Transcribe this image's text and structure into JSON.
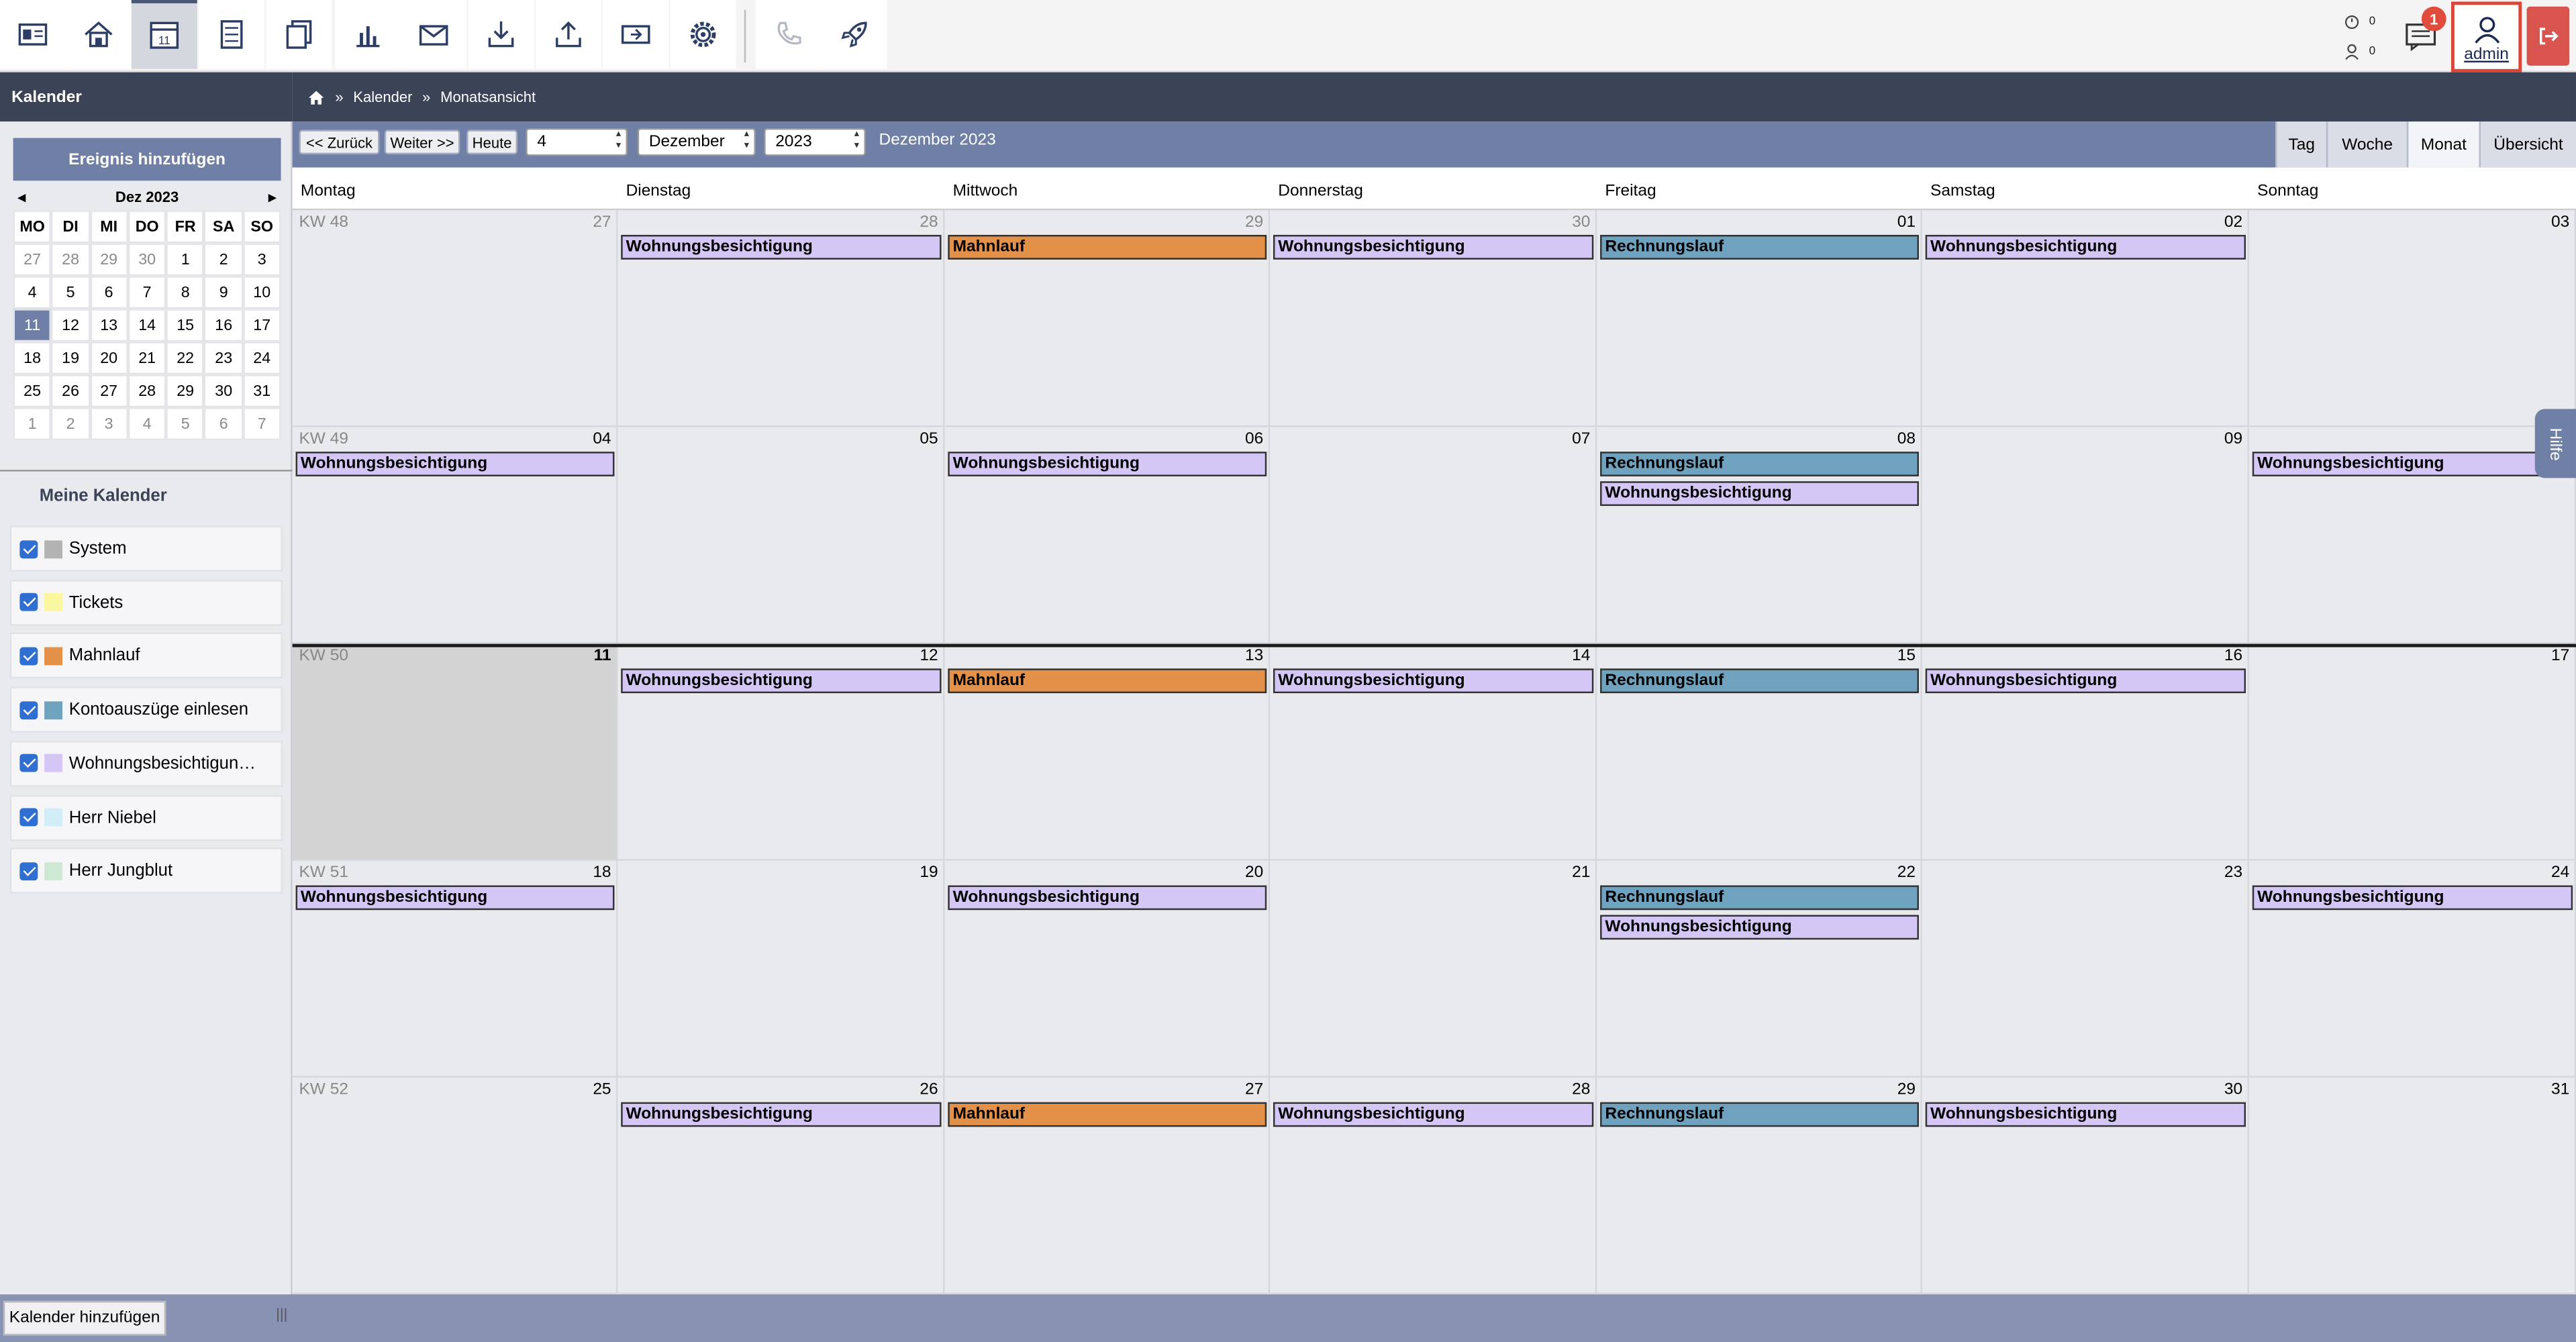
{
  "toolbar": {
    "icons": [
      "contacts-icon",
      "home-icon",
      "calendar-icon",
      "accounting-icon",
      "documents-icon",
      "reports-icon",
      "mail-icon",
      "import-icon",
      "export-icon",
      "ticket-icon",
      "settings-icon",
      "phone-icon",
      "rocket-icon"
    ],
    "calendar_day": "11",
    "stat_a": "0",
    "stat_b": "0",
    "message_badge": "1",
    "user": "admin"
  },
  "sidebar": {
    "title": "Kalender",
    "add_event": "Ereignis hinzufügen",
    "mini_month": "Dez 2023",
    "prev": "◂",
    "next": "▸",
    "dow": [
      "MO",
      "DI",
      "MI",
      "DO",
      "FR",
      "SA",
      "SO"
    ],
    "weeks": [
      [
        "27",
        "28",
        "29",
        "30",
        "1",
        "2",
        "3"
      ],
      [
        "4",
        "5",
        "6",
        "7",
        "8",
        "9",
        "10"
      ],
      [
        "11",
        "12",
        "13",
        "14",
        "15",
        "16",
        "17"
      ],
      [
        "18",
        "19",
        "20",
        "21",
        "22",
        "23",
        "24"
      ],
      [
        "25",
        "26",
        "27",
        "28",
        "29",
        "30",
        "31"
      ],
      [
        "1",
        "2",
        "3",
        "4",
        "5",
        "6",
        "7"
      ]
    ],
    "my_calendars_title": "Meine Kalender",
    "calendars": [
      {
        "label": "System",
        "color": "#b3b3b3"
      },
      {
        "label": "Tickets",
        "color": "#fbf7a0"
      },
      {
        "label": "Mahnlauf",
        "color": "#e39148"
      },
      {
        "label": "Kontoauszüge einlesen",
        "color": "#6ea2bf"
      },
      {
        "label": "Wohnungsbesichtigun…",
        "color": "#d4c6f5"
      },
      {
        "label": "Herr Niebel",
        "color": "#d2ecf8"
      },
      {
        "label": "Herr Jungblut",
        "color": "#cfe8d4"
      }
    ],
    "add_calendar": "Kalender hinzufügen",
    "grip": "|||"
  },
  "breadcrumb": {
    "sep": "»",
    "items": [
      "Kalender",
      "Monatsansicht"
    ]
  },
  "nav": {
    "back": "<< Zurück",
    "next": "Weiter >>",
    "today": "Heute",
    "week_value": "4",
    "month_value": "Dezember",
    "year_value": "2023",
    "current": "Dezember 2023",
    "views": [
      "Tag",
      "Woche",
      "Monat",
      "Übersicht"
    ],
    "active_view": "Monat"
  },
  "weekdays": [
    "Montag",
    "Dienstag",
    "Mittwoch",
    "Donnerstag",
    "Freitag",
    "Samstag",
    "Sonntag"
  ],
  "weeks": [
    {
      "kw": "KW 48",
      "days": [
        "27",
        "28",
        "29",
        "30",
        "01",
        "02",
        "03"
      ],
      "muted": [
        true,
        true,
        true,
        true,
        false,
        false,
        false
      ]
    },
    {
      "kw": "KW 49",
      "days": [
        "04",
        "05",
        "06",
        "07",
        "08",
        "09",
        "10"
      ],
      "muted": [
        false,
        false,
        false,
        false,
        false,
        false,
        false
      ]
    },
    {
      "kw": "KW 50",
      "days": [
        "11",
        "12",
        "13",
        "14",
        "15",
        "16",
        "17"
      ],
      "muted": [
        false,
        false,
        false,
        false,
        false,
        false,
        false
      ]
    },
    {
      "kw": "KW 51",
      "days": [
        "18",
        "19",
        "20",
        "21",
        "22",
        "23",
        "24"
      ],
      "muted": [
        false,
        false,
        false,
        false,
        false,
        false,
        false
      ]
    },
    {
      "kw": "KW 52",
      "days": [
        "25",
        "26",
        "27",
        "28",
        "29",
        "30",
        "31"
      ],
      "muted": [
        false,
        false,
        false,
        false,
        false,
        false,
        false
      ]
    }
  ],
  "event_types": {
    "w": "Wohnungsbesichtigung",
    "m": "Mahnlauf",
    "r": "Rechnungslauf"
  },
  "events": [
    {
      "week": 0,
      "day": 1,
      "slot": 0,
      "type": "w"
    },
    {
      "week": 0,
      "day": 2,
      "slot": 0,
      "type": "m"
    },
    {
      "week": 0,
      "day": 3,
      "slot": 0,
      "type": "w"
    },
    {
      "week": 0,
      "day": 4,
      "slot": 0,
      "type": "r"
    },
    {
      "week": 0,
      "day": 5,
      "slot": 0,
      "type": "w"
    },
    {
      "week": 1,
      "day": 0,
      "slot": 0,
      "type": "w"
    },
    {
      "week": 1,
      "day": 2,
      "slot": 0,
      "type": "w"
    },
    {
      "week": 1,
      "day": 4,
      "slot": 0,
      "type": "r"
    },
    {
      "week": 1,
      "day": 4,
      "slot": 1,
      "type": "w"
    },
    {
      "week": 1,
      "day": 6,
      "slot": 0,
      "type": "w"
    },
    {
      "week": 2,
      "day": 1,
      "slot": 0,
      "type": "w"
    },
    {
      "week": 2,
      "day": 2,
      "slot": 0,
      "type": "m"
    },
    {
      "week": 2,
      "day": 3,
      "slot": 0,
      "type": "w"
    },
    {
      "week": 2,
      "day": 4,
      "slot": 0,
      "type": "r"
    },
    {
      "week": 2,
      "day": 5,
      "slot": 0,
      "type": "w"
    },
    {
      "week": 3,
      "day": 0,
      "slot": 0,
      "type": "w"
    },
    {
      "week": 3,
      "day": 2,
      "slot": 0,
      "type": "w"
    },
    {
      "week": 3,
      "day": 4,
      "slot": 0,
      "type": "r"
    },
    {
      "week": 3,
      "day": 4,
      "slot": 1,
      "type": "w"
    },
    {
      "week": 3,
      "day": 6,
      "slot": 0,
      "type": "w"
    },
    {
      "week": 4,
      "day": 1,
      "slot": 0,
      "type": "w"
    },
    {
      "week": 4,
      "day": 2,
      "slot": 0,
      "type": "m"
    },
    {
      "week": 4,
      "day": 3,
      "slot": 0,
      "type": "w"
    },
    {
      "week": 4,
      "day": 4,
      "slot": 0,
      "type": "r"
    },
    {
      "week": 4,
      "day": 5,
      "slot": 0,
      "type": "w"
    }
  ],
  "help_tab": "Hilfe"
}
